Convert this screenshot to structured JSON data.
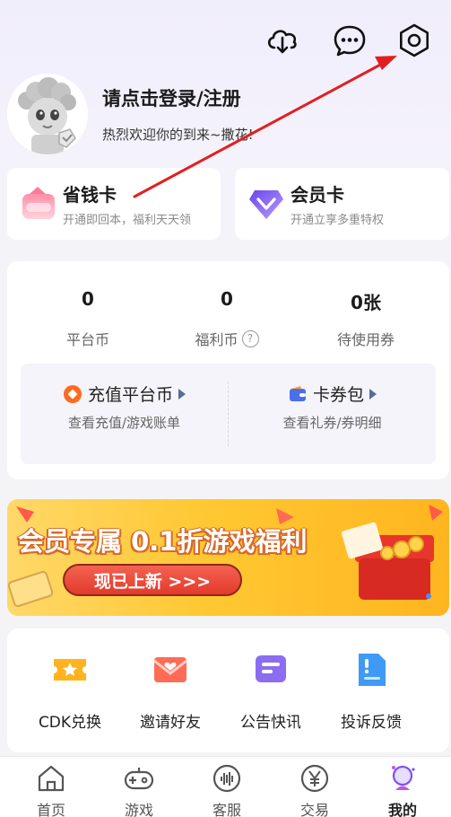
{
  "header": {
    "cloud_icon": "cloud-download-icon",
    "message_icon": "message-icon",
    "settings_icon": "gear-icon"
  },
  "profile": {
    "login_label": "请点击登录/注册",
    "welcome": "热烈欢迎你的到来~撒花!"
  },
  "cards": {
    "save": {
      "title": "省钱卡",
      "subtitle": "开通即回本，福利天天领"
    },
    "vip": {
      "title": "会员卡",
      "subtitle": "开通立享多重特权"
    }
  },
  "wallet": {
    "stats": [
      {
        "value": "0",
        "label": "平台币"
      },
      {
        "value": "0",
        "label": "福利币"
      },
      {
        "value": "0张",
        "label": "待使用券"
      }
    ],
    "help_glyph": "?",
    "recharge": {
      "title": "充值平台币",
      "subtitle": "查看充值/游戏账单"
    },
    "coupons": {
      "title": "卡券包",
      "subtitle": "查看礼券/券明细"
    }
  },
  "banner": {
    "title": "会员专属 0.1折游戏福利",
    "button": "现已上新 >>>"
  },
  "tools": [
    {
      "label": "CDK兑换",
      "icon": "ticket-icon"
    },
    {
      "label": "邀请好友",
      "icon": "envelope-icon"
    },
    {
      "label": "公告快讯",
      "icon": "notice-icon"
    },
    {
      "label": "投诉反馈",
      "icon": "feedback-icon"
    }
  ],
  "nav": [
    {
      "label": "首页",
      "icon": "home-icon"
    },
    {
      "label": "游戏",
      "icon": "gamepad-icon"
    },
    {
      "label": "客服",
      "icon": "service-icon"
    },
    {
      "label": "交易",
      "icon": "yen-icon"
    },
    {
      "label": "我的",
      "icon": "profile-icon",
      "active": true
    }
  ],
  "colors": {
    "accent_red": "#e23a2d",
    "banner_yellow": "#ffc832",
    "vip_purple": "#7b52f0",
    "annotation_arrow": "#e02020"
  }
}
